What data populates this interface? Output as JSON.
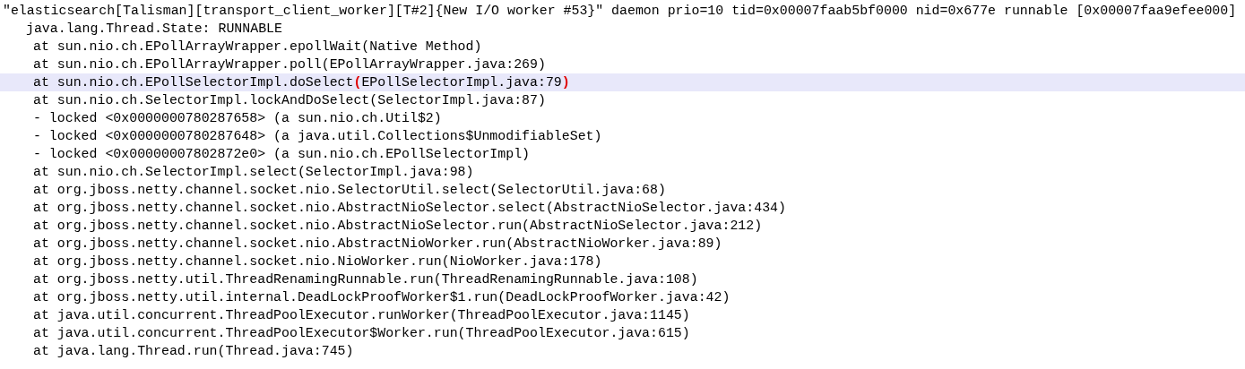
{
  "editor": {
    "lines": [
      {
        "kind": "header",
        "selected": false,
        "text": "\"elasticsearch[Talisman][transport_client_worker][T#2]{New I/O worker #53}\" daemon prio=10 tid=0x00007faab5bf0000 nid=0x677e runnable [0x00007faa9efee000]"
      },
      {
        "kind": "state",
        "selected": false,
        "text": "java.lang.Thread.State: RUNNABLE"
      },
      {
        "kind": "frame",
        "selected": false,
        "text": "at sun.nio.ch.EPollArrayWrapper.epollWait(Native Method)"
      },
      {
        "kind": "frame",
        "selected": false,
        "text": "at sun.nio.ch.EPollArrayWrapper.poll(EPollArrayWrapper.java:269)"
      },
      {
        "kind": "frame",
        "selected": true,
        "segments": [
          {
            "text": "at sun.nio.ch.EPollSelectorImpl.doSelect",
            "bracket_match": false
          },
          {
            "text": "(",
            "bracket_match": true
          },
          {
            "text": "EPollSelectorImpl.java:79",
            "bracket_match": false
          },
          {
            "text": ")",
            "bracket_match": true
          }
        ]
      },
      {
        "kind": "frame",
        "selected": false,
        "text": "at sun.nio.ch.SelectorImpl.lockAndDoSelect(SelectorImpl.java:87)"
      },
      {
        "kind": "lock",
        "selected": false,
        "text": "- locked <0x0000000780287658> (a sun.nio.ch.Util$2)"
      },
      {
        "kind": "lock",
        "selected": false,
        "text": "- locked <0x0000000780287648> (a java.util.Collections$UnmodifiableSet)"
      },
      {
        "kind": "lock",
        "selected": false,
        "text": "- locked <0x00000007802872e0> (a sun.nio.ch.EPollSelectorImpl)"
      },
      {
        "kind": "frame",
        "selected": false,
        "text": "at sun.nio.ch.SelectorImpl.select(SelectorImpl.java:98)"
      },
      {
        "kind": "frame",
        "selected": false,
        "text": "at org.jboss.netty.channel.socket.nio.SelectorUtil.select(SelectorUtil.java:68)"
      },
      {
        "kind": "frame",
        "selected": false,
        "text": "at org.jboss.netty.channel.socket.nio.AbstractNioSelector.select(AbstractNioSelector.java:434)"
      },
      {
        "kind": "frame",
        "selected": false,
        "text": "at org.jboss.netty.channel.socket.nio.AbstractNioSelector.run(AbstractNioSelector.java:212)"
      },
      {
        "kind": "frame",
        "selected": false,
        "text": "at org.jboss.netty.channel.socket.nio.AbstractNioWorker.run(AbstractNioWorker.java:89)"
      },
      {
        "kind": "frame",
        "selected": false,
        "text": "at org.jboss.netty.channel.socket.nio.NioWorker.run(NioWorker.java:178)"
      },
      {
        "kind": "frame",
        "selected": false,
        "text": "at org.jboss.netty.util.ThreadRenamingRunnable.run(ThreadRenamingRunnable.java:108)"
      },
      {
        "kind": "frame",
        "selected": false,
        "text": "at org.jboss.netty.util.internal.DeadLockProofWorker$1.run(DeadLockProofWorker.java:42)"
      },
      {
        "kind": "frame",
        "selected": false,
        "text": "at java.util.concurrent.ThreadPoolExecutor.runWorker(ThreadPoolExecutor.java:1145)"
      },
      {
        "kind": "frame",
        "selected": false,
        "text": "at java.util.concurrent.ThreadPoolExecutor$Worker.run(ThreadPoolExecutor.java:615)"
      },
      {
        "kind": "frame",
        "selected": false,
        "text": "at java.lang.Thread.run(Thread.java:745)"
      }
    ]
  }
}
